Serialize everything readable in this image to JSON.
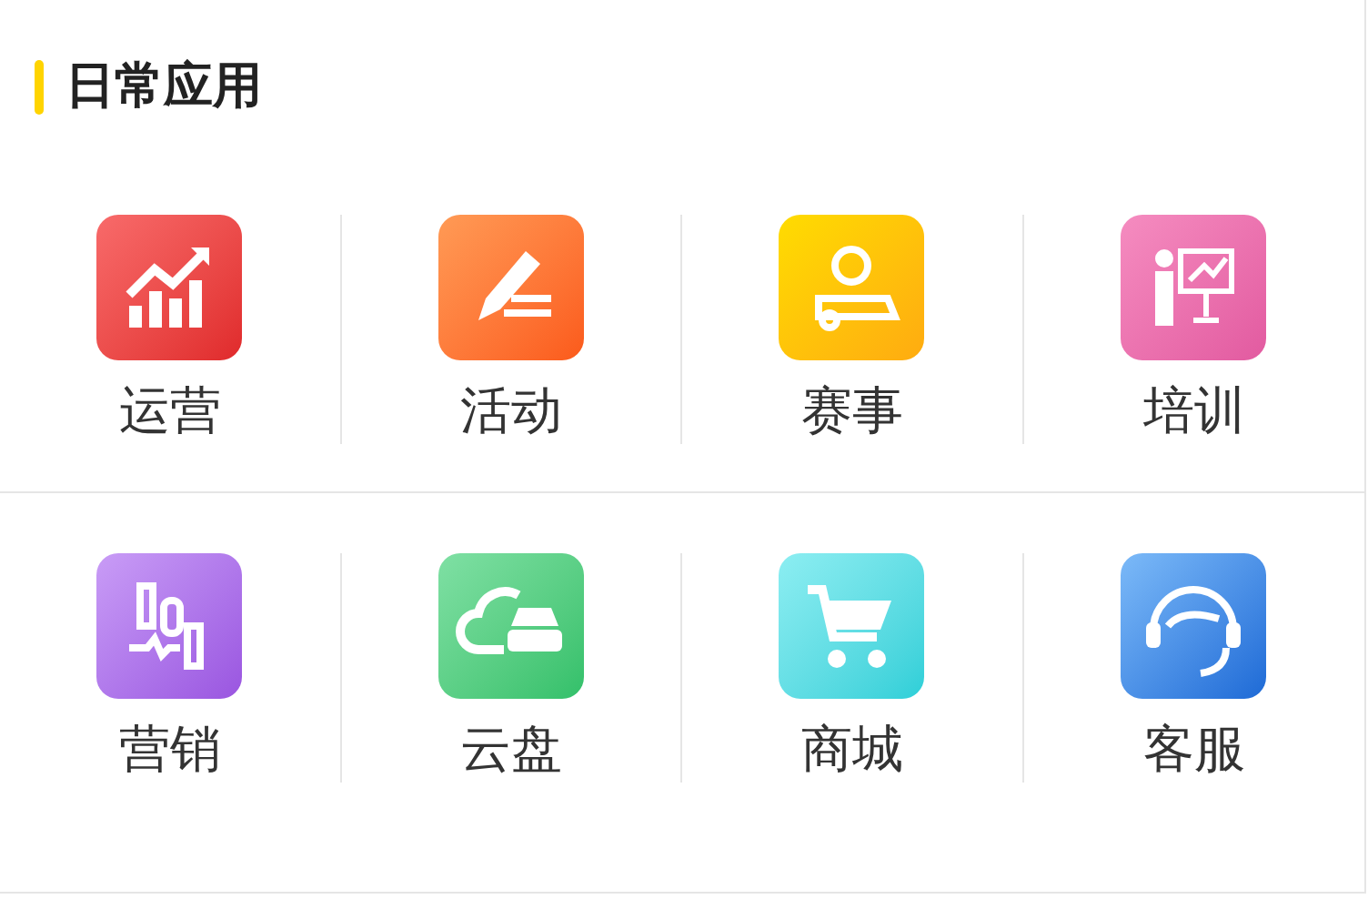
{
  "section": {
    "title": "日常应用"
  },
  "apps": [
    {
      "label": "运营"
    },
    {
      "label": "活动"
    },
    {
      "label": "赛事"
    },
    {
      "label": "培训"
    },
    {
      "label": "营销"
    },
    {
      "label": "云盘"
    },
    {
      "label": "商城"
    },
    {
      "label": "客服"
    }
  ]
}
